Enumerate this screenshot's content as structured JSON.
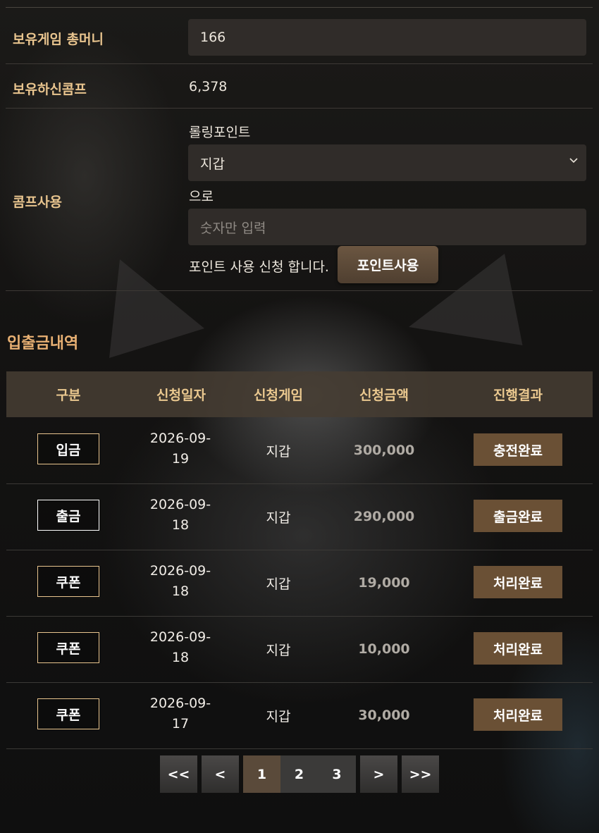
{
  "info": {
    "game_money_label": "보유게임 총머니",
    "game_money_value": "166",
    "comp_label": "보유하신콤프",
    "comp_value": "6,378",
    "comp_use_label": "콤프사용",
    "rolling_point_text": "롤링포인트",
    "wallet_select_value": "지갑",
    "to_text": "으로",
    "amount_placeholder": "숫자만 입력",
    "apply_text": "포인트 사용 신청 합니다.",
    "apply_button": "포인트사용"
  },
  "history": {
    "title": "입출금내역",
    "headers": [
      "구분",
      "신청일자",
      "신청게임",
      "신청금액",
      "진행결과"
    ],
    "rows": [
      {
        "type": "입금",
        "date_line1": "2026-09-",
        "date_line2": "19",
        "game": "지갑",
        "amount": "300,000",
        "status": "충전완료"
      },
      {
        "type": "출금",
        "date_line1": "2026-09-",
        "date_line2": "18",
        "game": "지갑",
        "amount": "290,000",
        "status": "출금완료"
      },
      {
        "type": "쿠폰",
        "date_line1": "2026-09-",
        "date_line2": "18",
        "game": "지갑",
        "amount": "19,000",
        "status": "처리완료"
      },
      {
        "type": "쿠폰",
        "date_line1": "2026-09-",
        "date_line2": "18",
        "game": "지갑",
        "amount": "10,000",
        "status": "처리완료"
      },
      {
        "type": "쿠폰",
        "date_line1": "2026-09-",
        "date_line2": "17",
        "game": "지갑",
        "amount": "30,000",
        "status": "처리완료"
      }
    ]
  },
  "pagination": {
    "first": "<<",
    "prev": "<",
    "pages": [
      "1",
      "2",
      "3"
    ],
    "current": "1",
    "next": ">",
    "last": ">>"
  },
  "colors": {
    "label": "#e8c48e",
    "section_title": "#e8b073",
    "status_bg": "#6a5035",
    "header_bg": "#463c32"
  }
}
